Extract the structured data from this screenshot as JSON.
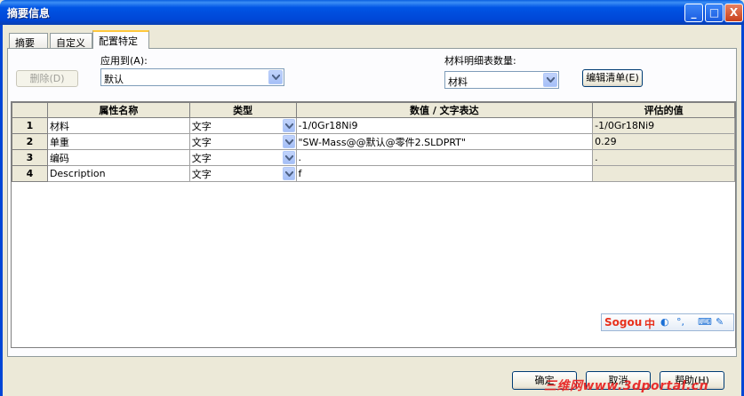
{
  "window": {
    "title": "摘要信息"
  },
  "titlebar_buttons": {
    "minimize": "_",
    "maximize": "□",
    "close": "X"
  },
  "tabs": [
    {
      "label": "摘要"
    },
    {
      "label": "自定义"
    },
    {
      "label": "配置特定"
    }
  ],
  "controls": {
    "delete_button": "删除(D)",
    "apply_to_label": "应用到(A):",
    "apply_to_value": "默认",
    "bom_qty_label": "材料明细表数量:",
    "bom_qty_value": "材料",
    "edit_list_button": "编辑清单(E)"
  },
  "grid": {
    "headers": [
      "",
      "属性名称",
      "类型",
      "数值 / 文字表达",
      "评估的值"
    ],
    "rows": [
      {
        "num": "1",
        "name": "材料",
        "type": "文字",
        "value": "-1/0Gr18Ni9",
        "evaluated": "-1/0Gr18Ni9"
      },
      {
        "num": "2",
        "name": "单重",
        "type": "文字",
        "value": "\"SW-Mass@@默认@零件2.SLDPRT\"",
        "evaluated": "0.29"
      },
      {
        "num": "3",
        "name": "编码",
        "type": "文字",
        "value": ".",
        "evaluated": "."
      },
      {
        "num": "4",
        "name": "Description",
        "type": "文字",
        "value": "f",
        "evaluated": ""
      }
    ]
  },
  "sogou": {
    "logo": "Sogou",
    "mode": "中",
    "punct": "°,"
  },
  "bottom_buttons": {
    "ok": "确定",
    "cancel": "取消",
    "help": "帮助(H)"
  },
  "watermark": "三维网www.3dportal.cn",
  "colors": {
    "titlebar": "#0055e5",
    "face": "#ece9d8",
    "active_tab_accent": "#ffc83c",
    "watermark": "#e81c1c"
  }
}
